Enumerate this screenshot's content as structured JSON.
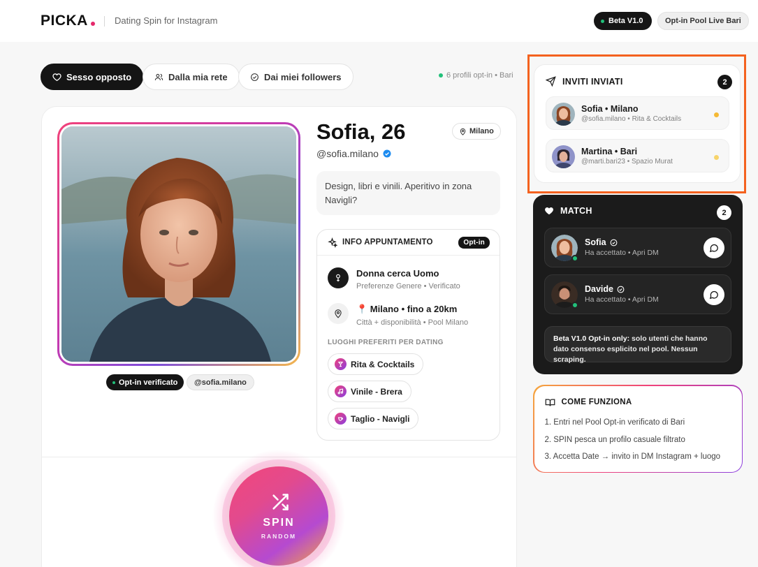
{
  "header": {
    "logo": "PICKA",
    "tagline": "Dating Spin for Instagram",
    "beta_badge": "Beta V1.0",
    "pool_badge": "Opt-in Pool Live Bari"
  },
  "filters": {
    "items": [
      {
        "label": "Sesso opposto",
        "icon": "heart-icon",
        "active": true
      },
      {
        "label": "Dalla mia rete",
        "icon": "users-icon",
        "active": false
      },
      {
        "label": "Dai miei followers",
        "icon": "check-circle-icon",
        "active": false
      }
    ],
    "pool_status": "6 profili opt-in • Bari"
  },
  "profile": {
    "name": "Sofia, 26",
    "handle": "@sofia.milano",
    "city": "Milano",
    "bio": "Design, libri e vinili. Aperitivo in zona Navigli?",
    "badge_verified": "Opt-in verificato",
    "badge_handle": "@sofia.milano"
  },
  "info": {
    "title": "INFO APPUNTAMENTO",
    "badge": "Opt-in",
    "rows": [
      {
        "title": "Donna cerca Uomo",
        "sub": "Preferenze Genere • Verificato",
        "icon": "gender-icon"
      },
      {
        "title": "📍 Milano • fino a 20km",
        "sub": "Città + disponibilità • Pool Milano",
        "icon": "location-pin-icon"
      }
    ],
    "places_label": "LUOGHI PREFERITI PER DATING",
    "places": [
      {
        "label": "Rita & Cocktails",
        "icon": "cocktail-icon"
      },
      {
        "label": "Vinile - Brera",
        "icon": "music-note-icon"
      },
      {
        "label": "Taglio - Navigli",
        "icon": "coffee-cup-icon"
      }
    ]
  },
  "spin": {
    "label": "SPIN",
    "sub": "RANDOM"
  },
  "invites": {
    "title": "INVITI INVIATI",
    "count": "2",
    "items": [
      {
        "title": "Sofia • Milano",
        "sub": "@sofia.milano • Rita & Cocktails",
        "status_color": "#f5b935"
      },
      {
        "title": "Martina • Bari",
        "sub": "@marti.bari23 • Spazio Murat",
        "status_color": "#f7d46b"
      }
    ]
  },
  "match": {
    "title": "MATCH",
    "count": "2",
    "items": [
      {
        "name": "Sofia",
        "sub": "Ha accettato • Apri DM"
      },
      {
        "name": "Davide",
        "sub": "Ha accettato • Apri DM"
      }
    ],
    "note_bold": "Beta V1.0 Opt-in only:",
    "note_text": " solo utenti che hanno dato consenso esplicito nel pool. Nessun scraping."
  },
  "how": {
    "title": "COME FUNZIONA",
    "steps": [
      "1. Entri nel Pool Opt-in verificato di Bari",
      "2. SPIN pesca un profilo casuale filtrato",
      "3. Accetta Date → invito in DM Instagram + luogo"
    ]
  },
  "colors": {
    "accent_pink": "#f0427a",
    "accent_purple": "#8a3ee0",
    "accent_orange": "#f5a73c",
    "online_green": "#22c07a",
    "highlight_orange": "#f4621f"
  }
}
